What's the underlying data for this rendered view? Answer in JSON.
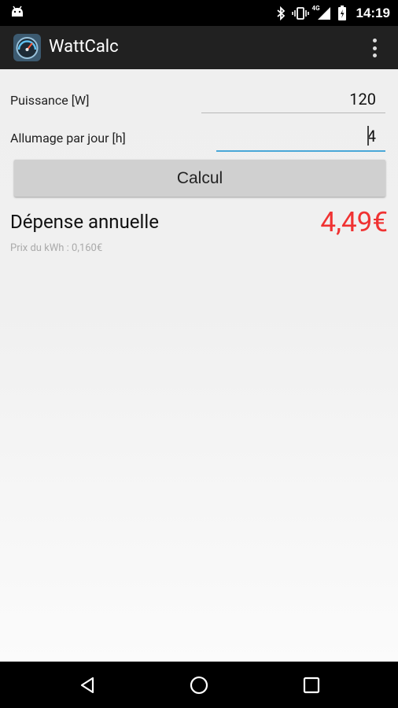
{
  "status_bar": {
    "time": "14:19",
    "network_label": "4G",
    "icons": [
      "android-icon",
      "bluetooth-icon",
      "vibrate-icon",
      "signal-icon",
      "battery-icon"
    ]
  },
  "action_bar": {
    "title": "WattCalc",
    "app_icon": "speedometer-icon",
    "overflow_icon": "overflow-menu-icon"
  },
  "form": {
    "power": {
      "label": "Puissance [W]",
      "value": "120"
    },
    "hours": {
      "label": "Allumage par jour [h]",
      "value": "4"
    },
    "calculate_label": "Calcul"
  },
  "result": {
    "label": "Dépense annuelle",
    "value": "4,49€",
    "price_note": "Prix du kWh : 0,160€"
  },
  "colors": {
    "action_bar_bg": "#212121",
    "result_red": "#f03232",
    "focus_blue": "#4aa8d8",
    "button_bg": "#d0d0d0"
  },
  "nav_bar": {
    "icons": [
      "back-icon",
      "home-icon",
      "recents-icon"
    ]
  }
}
